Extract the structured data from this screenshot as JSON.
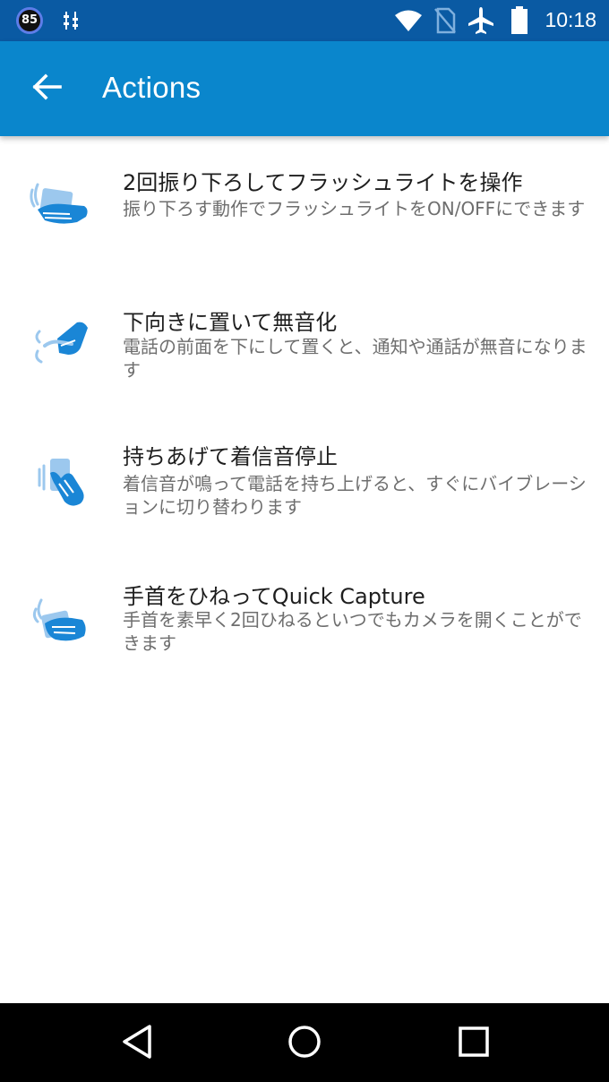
{
  "status_bar": {
    "battery_level": "85",
    "time": "10:18",
    "icons": [
      "battery-level-icon",
      "equalizer-icon",
      "wifi-icon",
      "no-sim-icon",
      "airplane-mode-icon",
      "battery-icon"
    ]
  },
  "app_bar": {
    "title": "Actions",
    "back_icon": "arrow-back-icon"
  },
  "actions": [
    {
      "title": "2回振り下ろしてフラッシュライトを操作",
      "description": "振り下ろす動作でフラッシュライトをON/OFFにできます",
      "icon": "chop-gesture-icon"
    },
    {
      "title": "下向きに置いて無音化",
      "description": "電話の前面を下にして置くと、通知や通話が無音になります",
      "icon": "flip-phone-icon"
    },
    {
      "title": "持ちあげて着信音停止",
      "description": "着信音が鳴って電話を持ち上げると、すぐにバイブレーションに切り替わります",
      "icon": "lift-phone-icon"
    },
    {
      "title": "手首をひねってQuick Capture",
      "description": "手首を素早く2回ひねるといつでもカメラを開くことができます",
      "icon": "twist-wrist-icon"
    }
  ],
  "nav_bar": {
    "icons": [
      "back-triangle-icon",
      "home-circle-icon",
      "recents-square-icon"
    ]
  },
  "colors": {
    "status_bar": "#0a5aa3",
    "app_bar": "#0a86cc",
    "icon_primary": "#1a86d6",
    "icon_secondary": "#9cc8ee",
    "title_text": "#1e1e1e",
    "description_text": "#6e6e6e",
    "nav_bar": "#000000"
  }
}
